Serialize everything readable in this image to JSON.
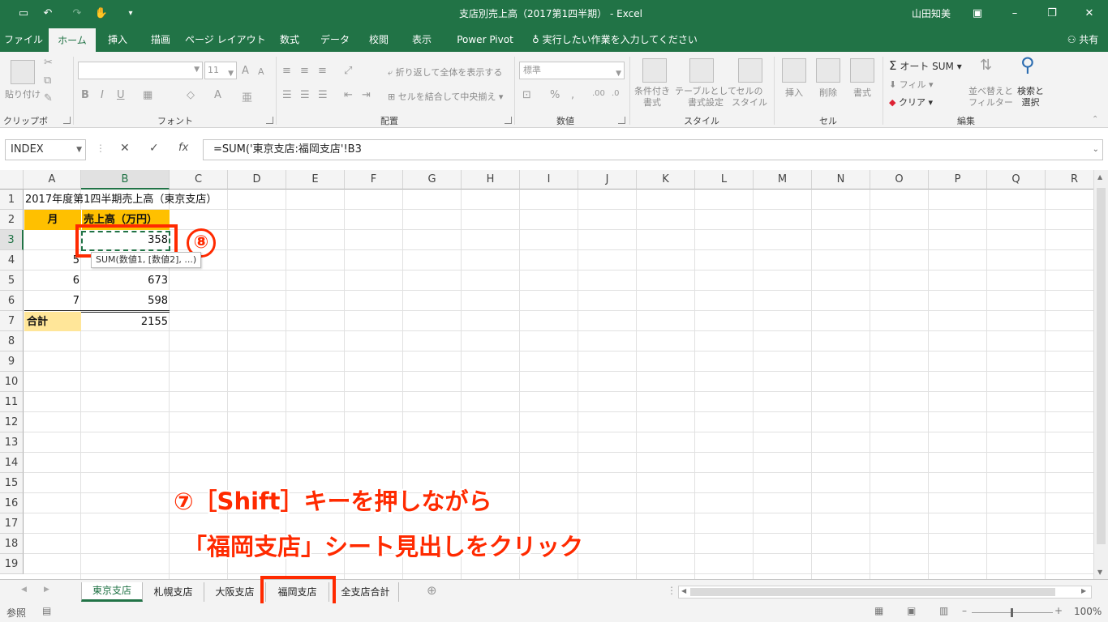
{
  "titlebar": {
    "doc_title": "支店別売上高（2017第1四半期）",
    "app_name": "-  Excel",
    "user": "山田知美",
    "win_minimize": "–",
    "win_restore": "❐",
    "win_close": "✕",
    "ribbon_toggle": "▣"
  },
  "tabs": [
    "ファイル",
    "ホーム",
    "挿入",
    "描画",
    "ページ レイアウト",
    "数式",
    "データ",
    "校閲",
    "表示",
    "Power Pivot"
  ],
  "tell_me": "実行したい作業を入力してください",
  "share": "共有",
  "ribbon": {
    "clipboard": {
      "label": "クリップボード",
      "paste": "貼り付け"
    },
    "font": {
      "label": "フォント",
      "size": "11",
      "bold": "B",
      "italic": "I",
      "underline": "U"
    },
    "alignment": {
      "label": "配置",
      "wrap": "折り返して全体を表示する",
      "merge": "セルを結合して中央揃え"
    },
    "number": {
      "label": "数値",
      "format": "標準",
      "percent": "%"
    },
    "styles": {
      "label": "スタイル",
      "conditional": "条件付き\n書式",
      "table": "テーブルとして\n書式設定",
      "cell": "セルの\nスタイル"
    },
    "cells": {
      "label": "セル",
      "insert": "挿入",
      "delete": "削除",
      "format": "書式"
    },
    "editing": {
      "label": "編集",
      "autosum": "オート SUM",
      "fill": "フィル",
      "clear": "クリア",
      "sort": "並べ替えと\nフィルター",
      "find": "検索と\n選択"
    }
  },
  "formula_bar": {
    "name_box": "INDEX",
    "cancel": "✕",
    "enter": "✓",
    "fx": "fx",
    "formula": "=SUM('東京支店:福岡支店'!B3"
  },
  "columns": [
    "A",
    "B",
    "C",
    "D",
    "E",
    "F",
    "G",
    "H",
    "I",
    "J",
    "K",
    "L",
    "M",
    "N",
    "O",
    "P",
    "Q",
    "R"
  ],
  "rows": [
    "1",
    "2",
    "3",
    "4",
    "5",
    "6",
    "7",
    "8",
    "9",
    "10",
    "11",
    "12",
    "13",
    "14",
    "15",
    "16",
    "17",
    "18",
    "19"
  ],
  "cells": {
    "a1": "2017年度第1四半期売上高（東京支店）",
    "a2": "月",
    "b2": "売上高（万円）",
    "b3": "358",
    "a4": "5",
    "a5": "6",
    "b5": "673",
    "a6": "7",
    "b6": "598",
    "a7": "合計",
    "b7": "2155"
  },
  "tooltip": "SUM(数値1, [数値2], ...)",
  "sheet_tabs": [
    "東京支店",
    "札幌支店",
    "大阪支店",
    "福岡支店",
    "全支店合計"
  ],
  "status": {
    "mode": "参照",
    "zoom": "100%"
  },
  "annotations": {
    "step8": "⑧",
    "step7_line1": "⑦［Shift］キーを押しながら",
    "step7_line2": "「福岡支店」シート見出しをクリック"
  },
  "colors": {
    "excel_green": "#217346",
    "highlight": "#ff2a00",
    "header_fill": "#ffc000",
    "total_fill": "#ffe699"
  }
}
